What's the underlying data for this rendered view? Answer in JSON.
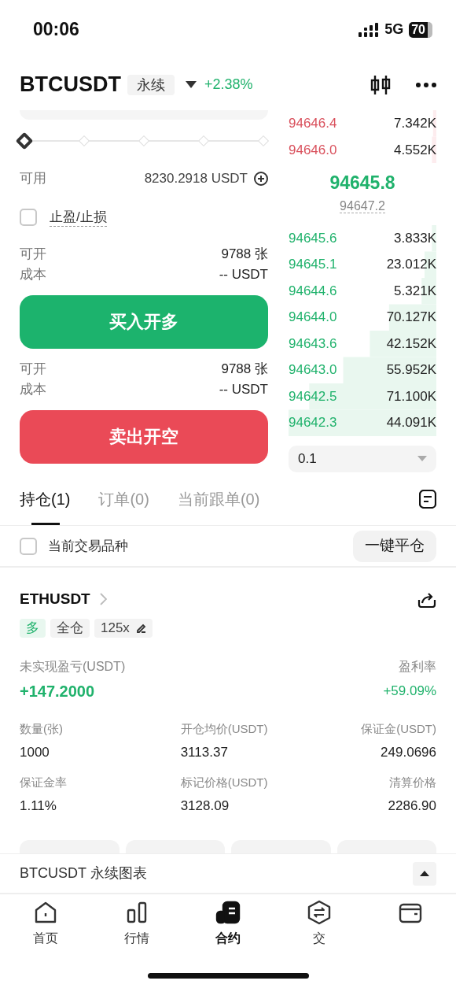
{
  "status_bar": {
    "time": "00:06",
    "network": "5G",
    "battery": "70"
  },
  "header": {
    "symbol": "BTCUSDT",
    "contract_type": "永续",
    "change": "+2.38%"
  },
  "order_form": {
    "leverage_slider": {
      "level": 0
    },
    "available_label": "可用",
    "available_value": "8230.2918 USDT",
    "tp_sl": {
      "label": "止盈/止损",
      "checked": false
    },
    "long": {
      "rows": [
        {
          "label": "可开",
          "value": "9788 张"
        },
        {
          "label": "成本",
          "value": "-- USDT"
        }
      ],
      "button": "买入开多"
    },
    "short": {
      "rows": [
        {
          "label": "可开",
          "value": "9788 张"
        },
        {
          "label": "成本",
          "value": "-- USDT"
        }
      ],
      "button": "卖出开空"
    }
  },
  "order_book": {
    "asks": [
      {
        "price": "94646.4",
        "amount": "7.342K"
      },
      {
        "price": "94646.0",
        "amount": "4.552K"
      }
    ],
    "last_price": "94645.8",
    "mark_price": "94647.2",
    "bids": [
      {
        "price": "94645.6",
        "amount": "3.833K"
      },
      {
        "price": "94645.1",
        "amount": "23.012K"
      },
      {
        "price": "94644.6",
        "amount": "5.321K"
      },
      {
        "price": "94644.0",
        "amount": "70.127K"
      },
      {
        "price": "94643.6",
        "amount": "42.152K"
      },
      {
        "price": "94643.0",
        "amount": "55.952K"
      },
      {
        "price": "94642.5",
        "amount": "71.100K"
      },
      {
        "price": "94642.3",
        "amount": "44.091K"
      }
    ],
    "precision": "0.1"
  },
  "tabs": [
    {
      "label": "持仓(1)",
      "selected": true
    },
    {
      "label": "订单(0)",
      "selected": false
    },
    {
      "label": "当前跟单(0)",
      "selected": false
    }
  ],
  "filter": {
    "label": "当前交易品种",
    "checked": false,
    "close_all": "一键平仓"
  },
  "position": {
    "symbol": "ETHUSDT",
    "tags": [
      {
        "kind": "side",
        "label": "多"
      },
      {
        "kind": "plain",
        "label": "全仓"
      },
      {
        "kind": "leverage",
        "label": "125x"
      }
    ],
    "pnl_label": "未实现盈亏(USDT)",
    "pnl": "+147.2000",
    "roe_label": "盈利率",
    "roe": "+59.09%",
    "fields": [
      {
        "label": "数量(张)",
        "value": "1000"
      },
      {
        "label": "开仓均价(USDT)",
        "value": "3113.37"
      },
      {
        "label": "保证金(USDT)",
        "value": "249.0696"
      },
      {
        "label": "保证金率",
        "value": "1.11%"
      },
      {
        "label": "标记价格(USDT)",
        "value": "3128.09"
      },
      {
        "label": "清算价格",
        "value": "2286.90"
      }
    ],
    "actions": [
      {
        "kind": "button"
      },
      {
        "kind": "button"
      },
      {
        "kind": "button"
      },
      {
        "kind": "button"
      }
    ]
  },
  "chart_bar": {
    "title": "BTCUSDT 永续图表"
  },
  "nav": [
    {
      "label": "首页",
      "selected": false
    },
    {
      "label": "行情",
      "selected": false
    },
    {
      "label": "合约",
      "selected": true
    },
    {
      "label": "交",
      "selected": false
    },
    {
      "selected": false
    }
  ]
}
